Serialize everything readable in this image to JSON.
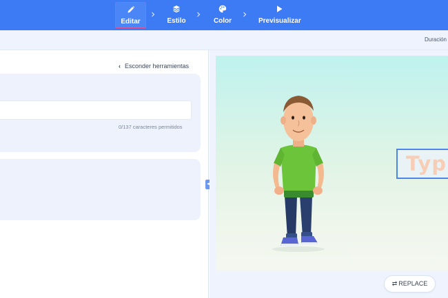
{
  "topbar": {
    "background": "#3d7bf4",
    "steps": [
      {
        "label": "Editar",
        "icon": "pencil-icon",
        "active": true
      },
      {
        "label": "Estilo",
        "icon": "layers-icon",
        "active": false
      },
      {
        "label": "Color",
        "icon": "palette-icon",
        "active": false
      },
      {
        "label": "Previsualizar",
        "icon": "play-icon",
        "active": false
      }
    ],
    "active_outline_color": "#e0559b"
  },
  "subbar": {
    "duration_label": "Duración"
  },
  "left_panel": {
    "hide_tools_label": "Esconder herramientas",
    "text_input": {
      "value": "",
      "placeholder": ""
    },
    "char_count": "0/137 caracteres permitidos"
  },
  "preview": {
    "text_box_label": "Typ",
    "character_icon": "cartoon-man-character",
    "replace_label": "REPLACE",
    "replace_icon": "swap-icon"
  }
}
